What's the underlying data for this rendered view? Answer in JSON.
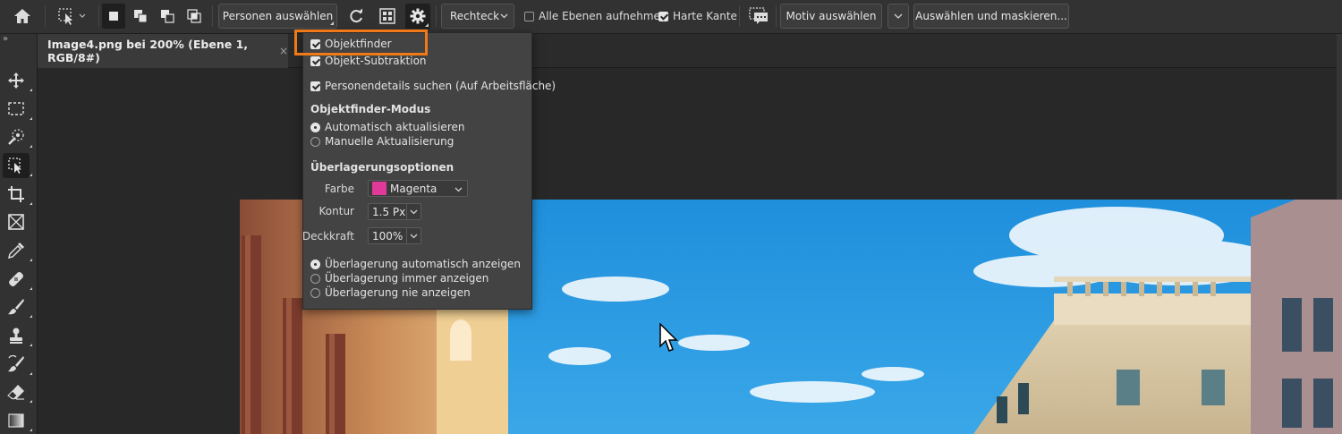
{
  "options_bar": {
    "home_icon": "home-icon",
    "tool_icon": "object-selection-icon",
    "mode_buttons": [
      "new-selection-icon",
      "add-selection-icon",
      "subtract-selection-icon",
      "intersect-selection-icon"
    ],
    "people_button": "Personen auswählen",
    "mode_select": "Rechteck",
    "sample_all_layers": "Alle Ebenen aufnehmen",
    "hard_edge": "Harte Kante",
    "select_subject": "Motiv auswählen",
    "select_and_mask": "Auswählen und maskieren..."
  },
  "document_tab": {
    "title": "Image4.png bei 200% (Ebene 1, RGB/8#)",
    "close": "×"
  },
  "panel": {
    "object_finder": "Objektfinder",
    "object_subtraction": "Objekt-Subtraktion",
    "person_details": "Personendetails suchen (Auf Arbeitsfläche)",
    "mode_heading": "Objektfinder-Modus",
    "mode_auto": "Automatisch aktualisieren",
    "mode_manual": "Manuelle Aktualisierung",
    "overlay_heading": "Überlagerungsoptionen",
    "color_label": "Farbe",
    "color_value": "Magenta",
    "color_swatch": "#e0399a",
    "stroke_label": "Kontur",
    "stroke_value": "1.5 Px",
    "opacity_label": "Deckkraft",
    "opacity_value": "100%",
    "overlay_auto": "Überlagerung automatisch anzeigen",
    "overlay_always": "Überlagerung immer anzeigen",
    "overlay_never": "Überlagerung nie anzeigen"
  },
  "colors": {
    "highlight": "#f07a18",
    "sky": "#2a9be0"
  },
  "toolbar": {
    "expand": "»"
  }
}
